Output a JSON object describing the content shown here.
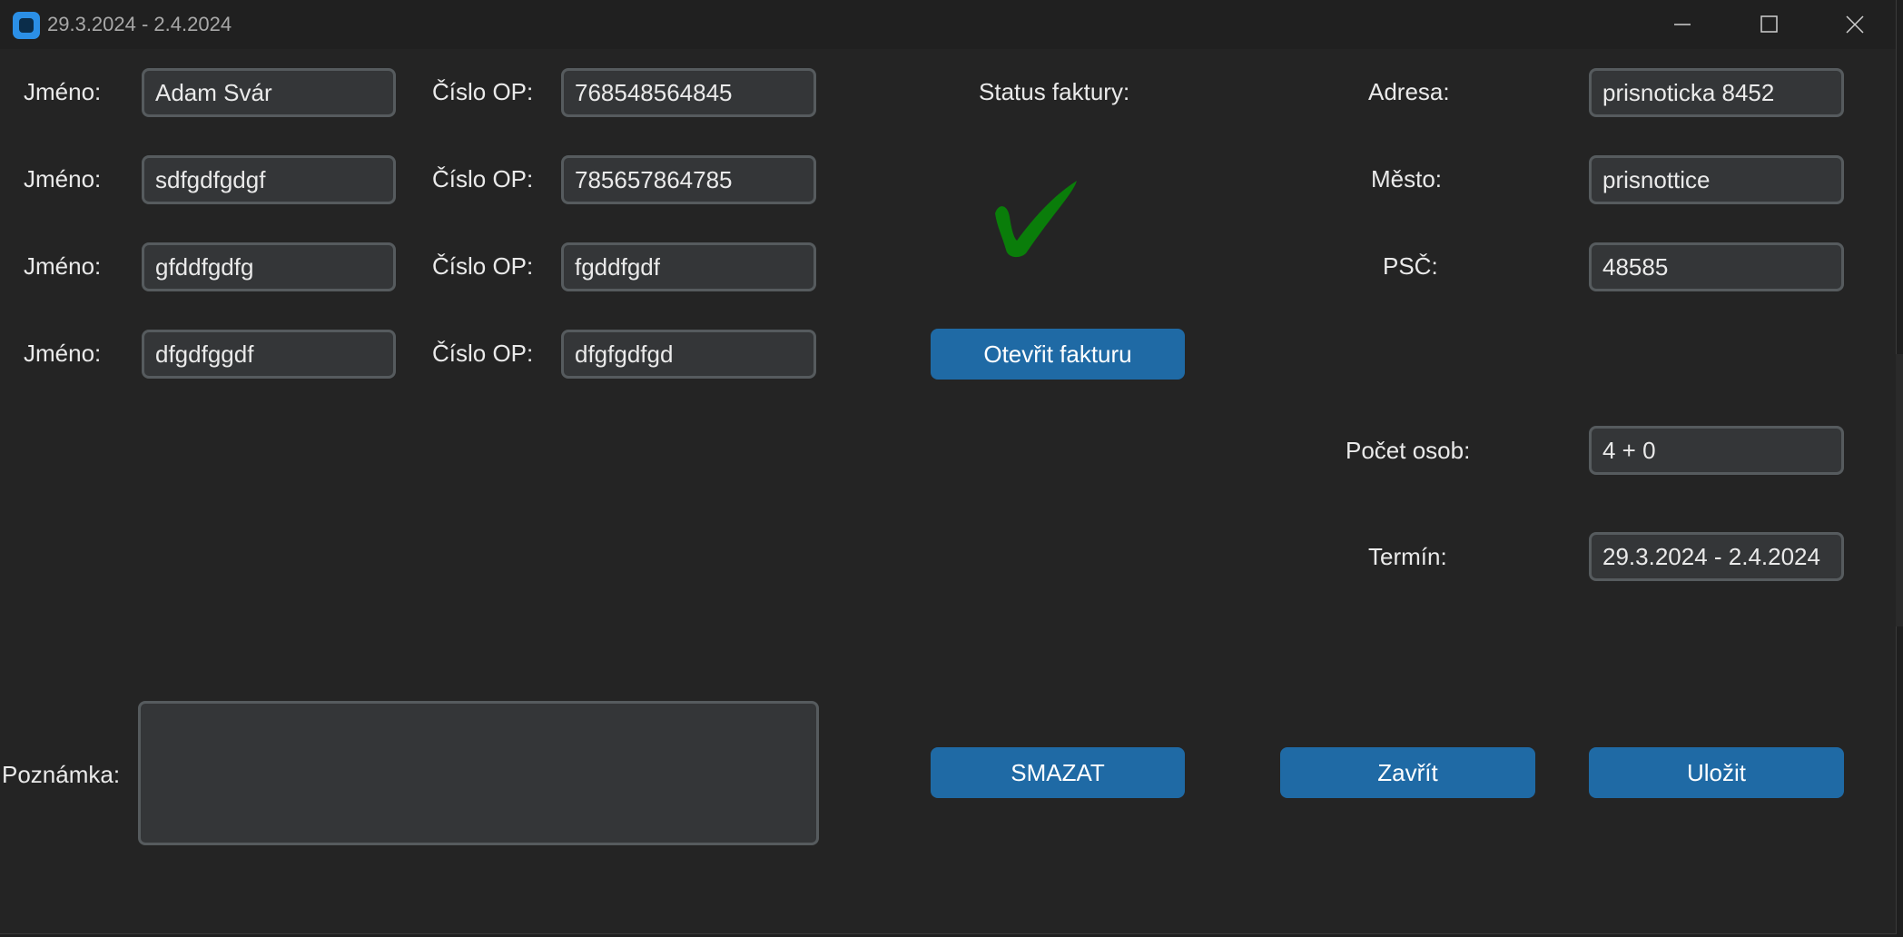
{
  "window": {
    "title": "29.3.2024  -  2.4.2024",
    "controls": {
      "minimize": "minimize-icon",
      "maximize": "maximize-icon",
      "close": "close-icon"
    }
  },
  "labels": {
    "name": "Jméno:",
    "id_number": "Číslo OP:",
    "invoice_status": "Status faktury:",
    "address": "Adresa:",
    "city": "Město:",
    "zip": "PSČ:",
    "person_count": "Počet osob:",
    "term": "Termín:",
    "note": "Poznámka:"
  },
  "guests": [
    {
      "name": "Adam Svár",
      "id": "768548564845"
    },
    {
      "name": "sdfgdfgdgf",
      "id": "785657864785"
    },
    {
      "name": "gfddfgdfg",
      "id": "fgddfgdf"
    },
    {
      "name": "dfgdfggdf",
      "id": "dfgfgdfgd"
    }
  ],
  "address": "prisnoticka 8452",
  "city": "prisnottice",
  "zip": "48585",
  "person_count": "4 + 0",
  "term": "29.3.2024 - 2.4.2024",
  "note": "",
  "status_icon": "checkmark-icon",
  "status_color": "#0a7d0a",
  "buttons": {
    "open_invoice": "Otevřit fakturu",
    "delete": "SMAZAT",
    "close": "Zavřít",
    "save": "Uložit"
  },
  "colors": {
    "accent": "#1f6aa5",
    "background": "#242424",
    "field": "#343638"
  }
}
